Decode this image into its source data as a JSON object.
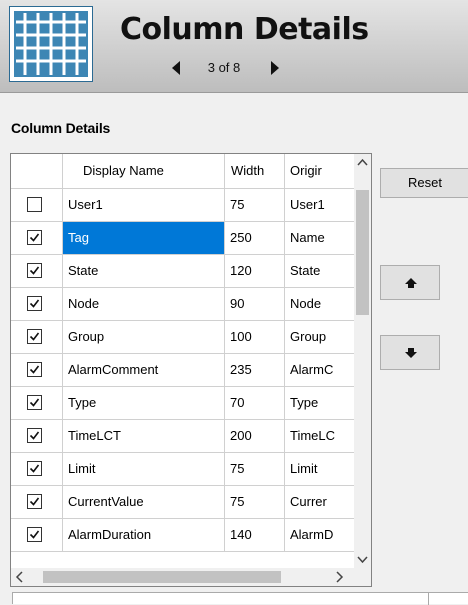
{
  "header": {
    "title": "Column Details",
    "pager_text": "3 of 8",
    "icon": "grid-icon"
  },
  "section_label": "Column Details",
  "grid": {
    "columns": [
      "",
      "Display Name",
      "Width",
      "Origir"
    ],
    "rows": [
      {
        "checked": false,
        "display_name": "User1",
        "width": "75",
        "original": "User1",
        "selected": false
      },
      {
        "checked": true,
        "display_name": "Tag",
        "width": "250",
        "original": "Name",
        "selected": true
      },
      {
        "checked": true,
        "display_name": "State",
        "width": "120",
        "original": "State",
        "selected": false
      },
      {
        "checked": true,
        "display_name": "Node",
        "width": "90",
        "original": "Node",
        "selected": false
      },
      {
        "checked": true,
        "display_name": "Group",
        "width": "100",
        "original": "Group",
        "selected": false
      },
      {
        "checked": true,
        "display_name": "AlarmComment",
        "width": "235",
        "original": "AlarmC",
        "selected": false
      },
      {
        "checked": true,
        "display_name": "Type",
        "width": "70",
        "original": "Type",
        "selected": false
      },
      {
        "checked": true,
        "display_name": "TimeLCT",
        "width": "200",
        "original": "TimeLC",
        "selected": false
      },
      {
        "checked": true,
        "display_name": "Limit",
        "width": "75",
        "original": "Limit",
        "selected": false
      },
      {
        "checked": true,
        "display_name": "CurrentValue",
        "width": "75",
        "original": "Currer",
        "selected": false
      },
      {
        "checked": true,
        "display_name": "AlarmDuration",
        "width": "140",
        "original": "AlarmD",
        "selected": false
      }
    ]
  },
  "buttons": {
    "reset": "Reset",
    "move_up_icon": "arrow-up-icon",
    "move_down_icon": "arrow-down-icon"
  },
  "colors": {
    "selection": "#0078d7",
    "header_icon": "#3d86b4"
  }
}
